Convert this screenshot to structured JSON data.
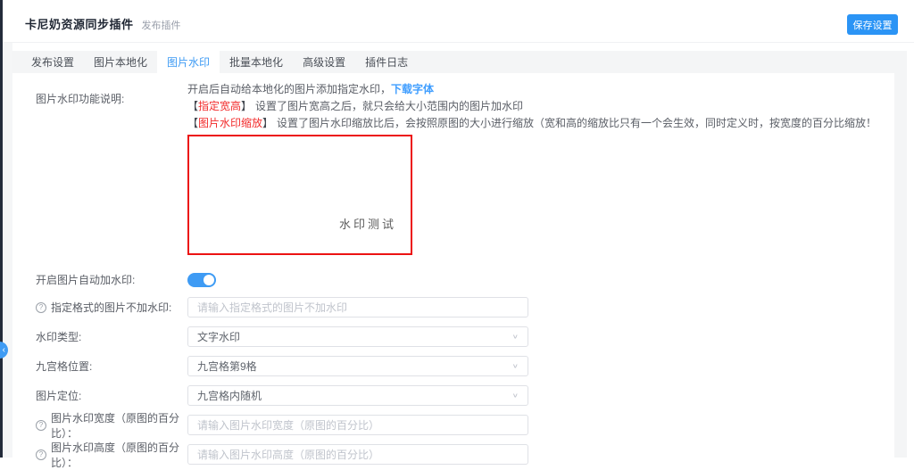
{
  "colors": {
    "accent_blue": "#3e9bf4",
    "button_blue": "#2b94f5",
    "danger_red": "#f22b2b",
    "preview_border_red": "#ec1313",
    "dark_rail": "#232b3a",
    "tabstrip_gray": "#f4f5f6"
  },
  "icons": {
    "help": "?",
    "chevron_down": "∨",
    "sidebar_handle": "‹"
  },
  "header": {
    "title": "卡尼奶资源同步插件",
    "subtitle": "发布插件",
    "save_button": "保存设置"
  },
  "tabs": [
    {
      "label": "发布设置",
      "active": false
    },
    {
      "label": "图片本地化",
      "active": false
    },
    {
      "label": "图片水印",
      "active": true
    },
    {
      "label": "批量本地化",
      "active": false
    },
    {
      "label": "高级设置",
      "active": false
    },
    {
      "label": "插件日志",
      "active": false
    }
  ],
  "notes": {
    "label": "图片水印功能说明:",
    "line1_text": "开启后自动给本地化的图片添加指定水印，",
    "line1_link": "下载字体",
    "line2_open": "【",
    "line2_tag": "指定宽高",
    "line2_close": "】",
    "line2_text": "设置了图片宽高之后，就只会给大小范围内的图片加水印",
    "line3_open": "【",
    "line3_tag": "图片水印缩放",
    "line3_close": "】",
    "line3_text": "设置了图片水印缩放比后，会按照原图的大小进行缩放（宽和高的缩放比只有一个会生效，同时定义时，按宽度的百分比缩放！"
  },
  "preview": {
    "watermark_text": "水印测试"
  },
  "form": {
    "switch_row": {
      "label": "开启图片自动加水印:",
      "state": "on"
    },
    "rows": [
      {
        "type": "input",
        "help": true,
        "label": "指定格式的图片不加水印:",
        "placeholder": "请输入指定格式的图片不加水印"
      },
      {
        "type": "select",
        "help": false,
        "label": "水印类型:",
        "value": "文字水印"
      },
      {
        "type": "select",
        "help": false,
        "label": "九宫格位置:",
        "value": "九宫格第9格"
      },
      {
        "type": "select",
        "help": false,
        "label": "图片定位:",
        "value": "九宫格内随机"
      },
      {
        "type": "input",
        "help": true,
        "label": "图片水印宽度（原图的百分比）：",
        "placeholder": "请输入图片水印宽度（原图的百分比）"
      },
      {
        "type": "input",
        "help": true,
        "label": "图片水印高度（原图的百分比）：",
        "placeholder": "请输入图片水印高度（原图的百分比）"
      }
    ]
  }
}
